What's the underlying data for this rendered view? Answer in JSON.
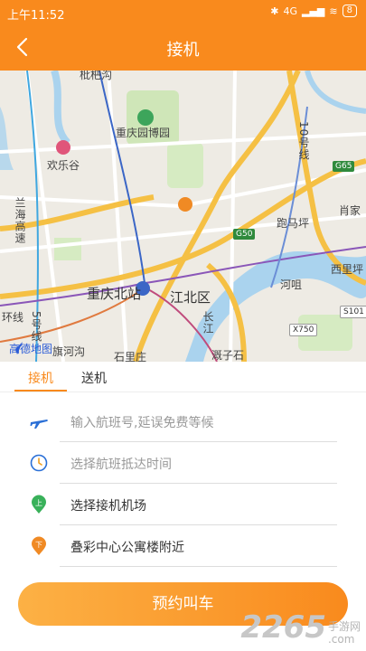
{
  "status_bar": {
    "time": "上午11:52",
    "network": "4G",
    "battery": "8"
  },
  "nav": {
    "title": "接机",
    "back_icon": "chevron-left-icon"
  },
  "map": {
    "labels": {
      "top_cut": "枇杷沟",
      "park": "重庆园博园",
      "happy_valley": "欢乐谷",
      "station": "重庆北站",
      "district": "江北区",
      "highway": "兰海高速",
      "line10": "10号线",
      "dimatou": "跑马坪",
      "xiaojia": "肖家",
      "chongqing_e": "西里坪",
      "river_area": "河咀",
      "yangtze": "长江",
      "qihe": "旗河沟",
      "line5": "5号线",
      "ring": "环线",
      "shimen": "溉子石",
      "shijia": "石里庄"
    },
    "road_signs": {
      "g65": "G65",
      "g50": "G50",
      "x750": "X750",
      "s101": "S101"
    },
    "logo": "高德地图"
  },
  "tabs": [
    {
      "label": "接机",
      "active": true
    },
    {
      "label": "送机",
      "active": false
    }
  ],
  "form": {
    "flight_placeholder": "输入航班号,延误免费等候",
    "arrival_time_placeholder": "选择航班抵达时间",
    "airport": "选择接机机场",
    "destination": "叠彩中心公寓楼附近"
  },
  "submit_label": "预约叫车",
  "watermark": {
    "number": "2265",
    "site_cn": "手游网",
    "site_en": ".com"
  },
  "colors": {
    "accent": "#f98a1d",
    "accent_light": "#fcb145",
    "map_bg": "#eeebe4",
    "river": "#aad3ee"
  }
}
